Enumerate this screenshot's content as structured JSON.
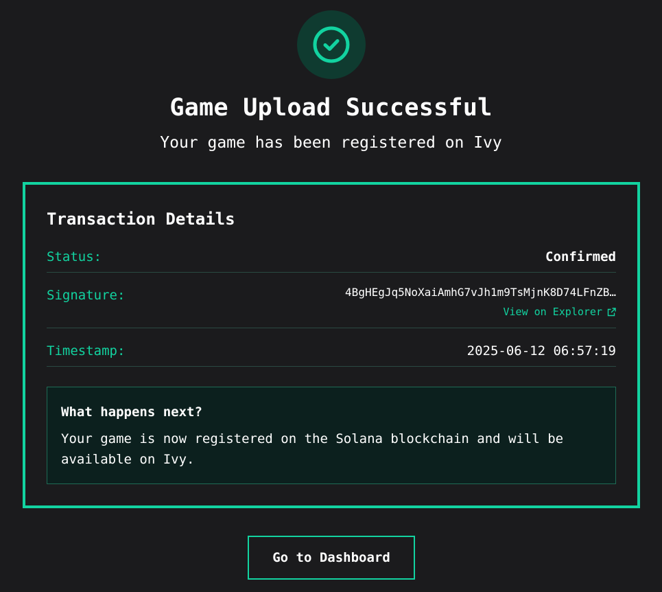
{
  "header": {
    "icon": "check-circle-icon",
    "title": "Game Upload Successful",
    "subtitle": "Your game has been registered on Ivy"
  },
  "transaction": {
    "title": "Transaction Details",
    "status_label": "Status:",
    "status_value": "Confirmed",
    "signature_label": "Signature:",
    "signature_value": "4BgHEgJq5NoXaiAmhG7vJh1m9TsMjnK8D74LFnZB…",
    "explorer_label": "View on Explorer",
    "explorer_icon": "external-link-icon",
    "timestamp_label": "Timestamp:",
    "timestamp_value": "2025-06-12 06:57:19"
  },
  "next_steps": {
    "title": "What happens next?",
    "body": "Your game is now registered on the Solana blockchain and will be available on Ivy."
  },
  "actions": {
    "dashboard_label": "Go to Dashboard"
  },
  "colors": {
    "accent": "#12d3a0",
    "background": "#1b1b1d",
    "badge_bg": "#0f3b30",
    "info_box_bg": "#0c201e"
  }
}
